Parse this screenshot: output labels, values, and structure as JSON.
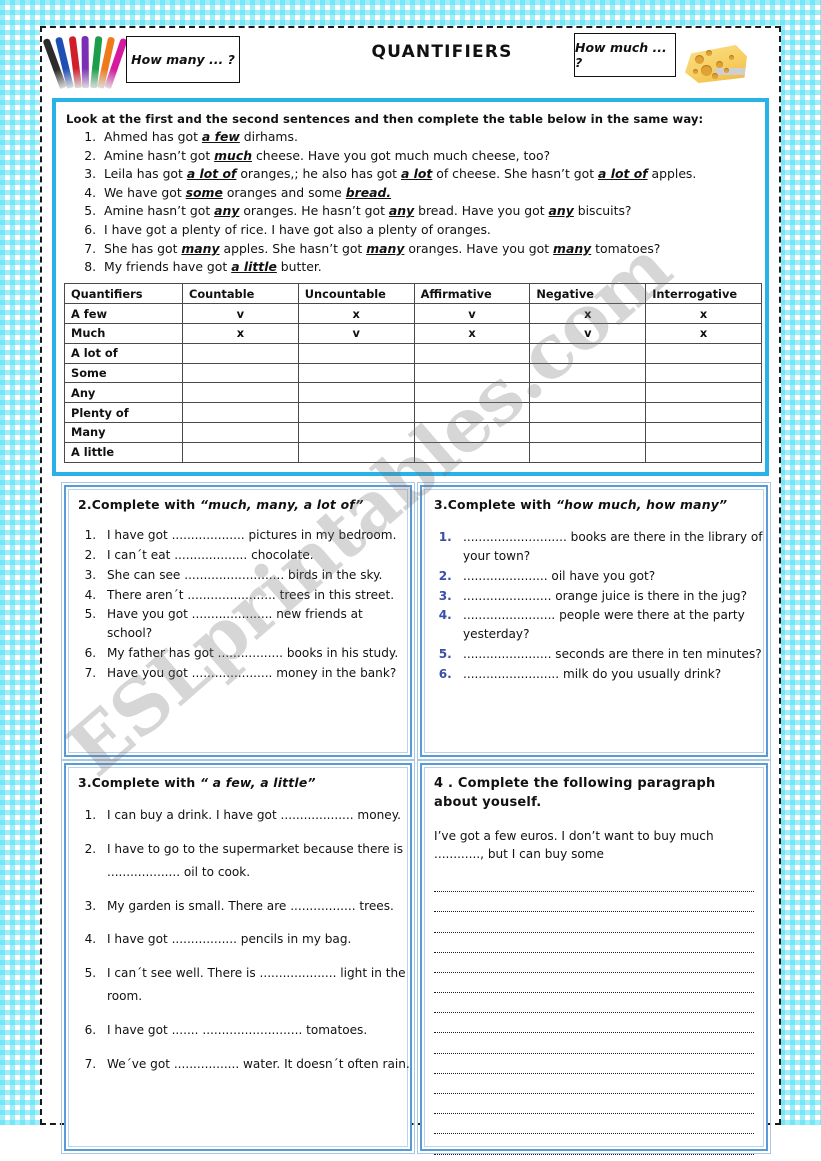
{
  "background": {
    "pattern": "cyan-gingham",
    "color": "#50e1f5"
  },
  "watermark": {
    "text": "ESLprintables.com"
  },
  "header": {
    "title": "QUANTIFIERS",
    "how_many_label": "How many ... ?",
    "how_much_label": "How much ... ?",
    "pens_icon": "colored-pens-icon",
    "cheese_icon": "swiss-cheese-icon",
    "pen_colors": [
      "#2b2b2b",
      "#1f4fb5",
      "#d01f2a",
      "#7b2fb5",
      "#1a9e4b",
      "#f07a1a",
      "#d61aa0"
    ]
  },
  "top_panel": {
    "accent_color": "#27b2e8",
    "instruction": "Look at the first and the second sentences and then complete the table below in the same way:",
    "sentences": [
      {
        "id": 1,
        "parts": [
          {
            "t": "Ahmed has got "
          },
          {
            "t": "a few",
            "b": true
          },
          {
            "t": " dirhams."
          }
        ]
      },
      {
        "id": 2,
        "parts": [
          {
            "t": "Amine hasn’t got "
          },
          {
            "t": "much",
            "b": true
          },
          {
            "t": " cheese. Have you got much much cheese, too?"
          }
        ]
      },
      {
        "id": 3,
        "parts": [
          {
            "t": "Leila has got "
          },
          {
            "t": "a lot of",
            "b": true
          },
          {
            "t": " oranges,; he also has got "
          },
          {
            "t": "a lot",
            "b": true
          },
          {
            "t": " of cheese. She hasn’t got "
          },
          {
            "t": "a lot of",
            "b": true
          },
          {
            "t": " apples."
          }
        ]
      },
      {
        "id": 4,
        "parts": [
          {
            "t": "We have got "
          },
          {
            "t": "some",
            "b": true
          },
          {
            "t": " oranges and some "
          },
          {
            "t": "bread.",
            "b": true
          }
        ]
      },
      {
        "id": 5,
        "parts": [
          {
            "t": "Amine hasn’t got "
          },
          {
            "t": "any",
            "b": true
          },
          {
            "t": " oranges. He hasn’t got "
          },
          {
            "t": "any",
            "b": true
          },
          {
            "t": " bread. Have you got "
          },
          {
            "t": "any",
            "b": true
          },
          {
            "t": " biscuits?"
          }
        ]
      },
      {
        "id": 6,
        "parts": [
          {
            "t": "I have got a plenty of rice. I have got also a plenty of oranges."
          }
        ]
      },
      {
        "id": 7,
        "parts": [
          {
            "t": "She has got "
          },
          {
            "t": "many",
            "b": true
          },
          {
            "t": " apples. She hasn’t got "
          },
          {
            "t": "many",
            "b": true
          },
          {
            "t": " oranges. Have you got "
          },
          {
            "t": "many",
            "b": true
          },
          {
            "t": " tomatoes?"
          }
        ]
      },
      {
        "id": 8,
        "parts": [
          {
            "t": "My friends have got "
          },
          {
            "t": "a little",
            "b": true
          },
          {
            "t": " butter."
          }
        ]
      }
    ],
    "table": {
      "headers": [
        "Quantifiers",
        "Countable",
        "Uncountable",
        "Affirmative",
        "Negative",
        "Interrogative"
      ],
      "rows": [
        {
          "label": "A few",
          "cells": [
            "v",
            "x",
            "v",
            "x",
            "x"
          ]
        },
        {
          "label": "Much",
          "cells": [
            "x",
            "v",
            "x",
            "v",
            "x"
          ]
        },
        {
          "label": "A lot of",
          "cells": [
            "",
            "",
            "",
            "",
            ""
          ]
        },
        {
          "label": "Some",
          "cells": [
            "",
            "",
            "",
            "",
            ""
          ]
        },
        {
          "label": "Any",
          "cells": [
            "",
            "",
            "",
            "",
            ""
          ]
        },
        {
          "label": "Plenty of",
          "cells": [
            "",
            "",
            "",
            "",
            ""
          ]
        },
        {
          "label": "Many",
          "cells": [
            "",
            "",
            "",
            "",
            ""
          ]
        },
        {
          "label": "A little",
          "cells": [
            "",
            "",
            "",
            "",
            ""
          ]
        }
      ]
    }
  },
  "exercise_2": {
    "title_prefix": "2.Complete with ",
    "title_quoted": "“much, many, a lot of”",
    "items": [
      "I have got ................... pictures in my bedroom.",
      "I can´t eat ................... chocolate.",
      "She can see .......................... birds in the sky.",
      "There aren´t ....................... trees in this street.",
      "Have you got ..................... new friends at school?",
      "My father has got ................. books in his study.",
      "Have you got ..................... money in the bank?"
    ]
  },
  "exercise_3a": {
    "title_prefix": "3.Complete with ",
    "title_quoted": "“how much, how many”",
    "number_color": "#3b4fa8",
    "items": [
      "........................... books are there in the library of your town?",
      "...................... oil have you got?",
      "....................... orange juice is there in the jug?",
      "........................ people were there at the party yesterday?",
      "....................... seconds are there in ten minutes?",
      "......................... milk do you usually drink?"
    ]
  },
  "exercise_3b": {
    "title_prefix": "3.Complete with ",
    "title_quoted": "“  a few, a little”",
    "items": [
      "I can buy a drink. I have got ................... money.",
      "I have to go to the supermarket because there is ................... oil to cook.",
      "My garden is small. There are ................. trees.",
      "I have got ................. pencils in my bag.",
      "I can´t see well. There is .................... light in the room.",
      "I have got ....... .......................... tomatoes.",
      "We´ve got ................. water. It doesn´t often rain."
    ]
  },
  "exercise_4": {
    "title": "4 . Complete the following paragraph about youself.",
    "intro": "I’ve got a few euros. I don’t want to buy much ............, but I can buy some",
    "blank_line_count": 14
  }
}
